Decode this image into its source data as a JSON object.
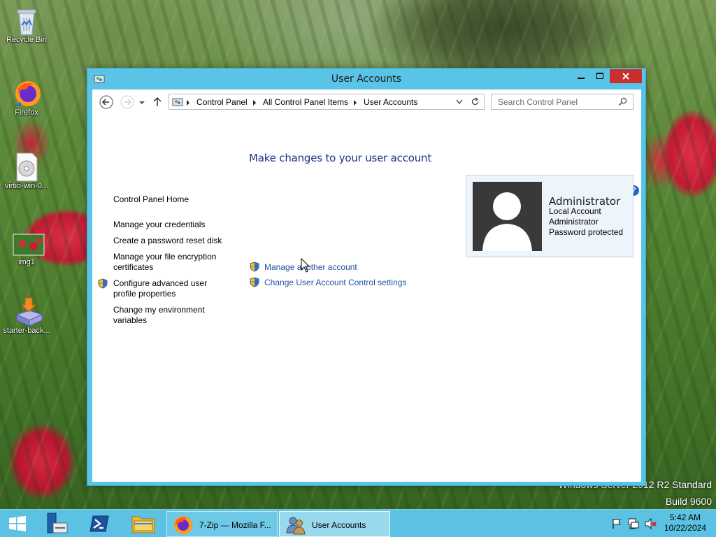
{
  "desktop": {
    "icons": [
      {
        "label": "Recycle Bin",
        "icon": "recycle-bin-icon"
      },
      {
        "label": "Firefox",
        "icon": "firefox-icon"
      },
      {
        "label": "virtio-win-0...",
        "icon": "disc-image-icon"
      },
      {
        "label": "img1",
        "icon": "image-file-icon"
      },
      {
        "label": "starter-back...",
        "icon": "installer-icon"
      }
    ],
    "watermark": {
      "line1": "Windows Server 2012 R2 Standard",
      "line2": "Build 9600"
    }
  },
  "window": {
    "title": "User Accounts",
    "controls": {
      "minimize": "minimize",
      "maximize": "maximize",
      "close": "close"
    },
    "nav": {
      "breadcrumbs": [
        "Control Panel",
        "All Control Panel Items",
        "User Accounts"
      ],
      "search_placeholder": "Search Control Panel"
    },
    "left_pane": {
      "home": "Control Panel Home",
      "links": [
        {
          "label": "Manage your credentials"
        },
        {
          "label": "Create a password reset disk"
        },
        {
          "label": "Manage your file encryption certificates"
        },
        {
          "label": "Configure advanced user profile properties",
          "shield": true
        },
        {
          "label": "Change my environment variables"
        }
      ]
    },
    "main": {
      "heading": "Make changes to your user account",
      "tasks": [
        {
          "label": "Manage another account",
          "shield": true
        },
        {
          "label": "Change User Account Control settings",
          "shield": true
        }
      ],
      "help": "?"
    },
    "account": {
      "name": "Administrator",
      "type": "Local Account",
      "group": "Administrator",
      "status": "Password protected"
    }
  },
  "taskbar": {
    "start": "start-icon",
    "pinned": [
      "server-manager-icon",
      "powershell-icon",
      "file-explorer-icon"
    ],
    "apps": [
      {
        "label": "7-Zip — Mozilla F...",
        "icon": "firefox-icon",
        "active": false
      },
      {
        "label": "User Accounts",
        "icon": "user-accounts-icon",
        "active": true
      }
    ],
    "clock": {
      "time": "5:42 AM",
      "date": "10/22/2024"
    }
  },
  "colors": {
    "window_frame": "#5ac4e6",
    "close_button": "#c7302d",
    "heading": "#1e3287",
    "link": "#1f52a0",
    "taskbar": "#5bc2e4"
  }
}
